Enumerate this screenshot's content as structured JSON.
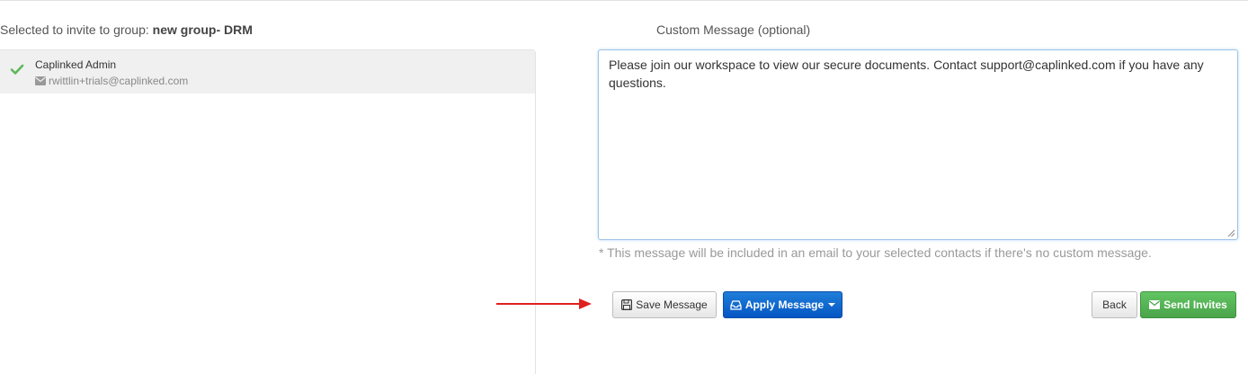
{
  "invite": {
    "heading_prefix": "Selected to invite to group: ",
    "group_name": "new group- DRM",
    "contacts": [
      {
        "name": "Caplinked Admin",
        "email": "rwittlin+trials@caplinked.com",
        "selected": true
      }
    ]
  },
  "message": {
    "label": "Custom Message (optional)",
    "text": "Please join our workspace to view our secure documents. Contact support@caplinked.com if you have any questions.",
    "note": "* This message will be included in an email to your selected contacts if there's no custom message."
  },
  "buttons": {
    "save": "Save Message",
    "apply": "Apply Message",
    "back": "Back",
    "send": "Send Invites"
  },
  "icons": {
    "check": "check-icon",
    "envelope": "envelope-icon",
    "save": "floppy-disk-icon",
    "apply": "inbox-icon",
    "apply_dropdown": "caret-down-icon",
    "send": "envelope-icon",
    "annotation": "red-arrow-right-icon"
  },
  "colors": {
    "check": "#5cb85c",
    "apply_button": "#0b63ce",
    "send_button": "#5cb85c",
    "annotation_arrow": "#e02020",
    "selected_row": "#f0f0f0"
  }
}
